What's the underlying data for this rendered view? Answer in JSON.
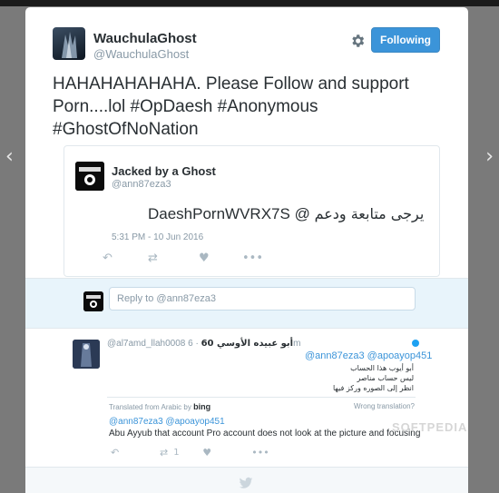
{
  "colors": {
    "accent": "#3b94d9",
    "muted": "#8899a6",
    "backdrop": "#7a7a7a"
  },
  "nav": {
    "prev_icon": "‹",
    "next_icon": "›"
  },
  "tweet": {
    "author_name": "WauchulaGhost",
    "author_handle": "@WauchulaGhost",
    "follow_label": "Following",
    "text": "HAHAHAHAHAHA. Please Follow and support Porn....lol #OpDaesh #Anonymous #GhostOfNoNation"
  },
  "quoted": {
    "name": "Jacked by a Ghost",
    "handle": "@ann87eza3",
    "text_latin": "DaeshPornWVRX7S @",
    "text_arabic": "يرجى متابعة ودعم",
    "timestamp": "5:31 PM - 10 Jun 2016"
  },
  "reply_box": {
    "placeholder": "Reply to @ann87eza3"
  },
  "reply": {
    "name": "أبو عبيده الأوسي 60",
    "handle": "@al7amd_llah0008",
    "time": "· 6m",
    "mentions": "@ann87eza3 @apoayop451",
    "arabic_lines": [
      "أبو أيوب هذا الحساب",
      "ليس حساب مناصر",
      "انظر إلى الصوره وركز فيها"
    ],
    "translated_by_prefix": "Translated from Arabic by",
    "translated_by_service": "bing",
    "wrong_translation": "Wrong translation?",
    "translated_mentions": "@ann87eza3 @apoayop451",
    "translated_text": "Abu Ayyub that account Pro account does not look at the picture and focusing",
    "retweet_count": "1"
  },
  "watermark": "SOFTPEDIA"
}
